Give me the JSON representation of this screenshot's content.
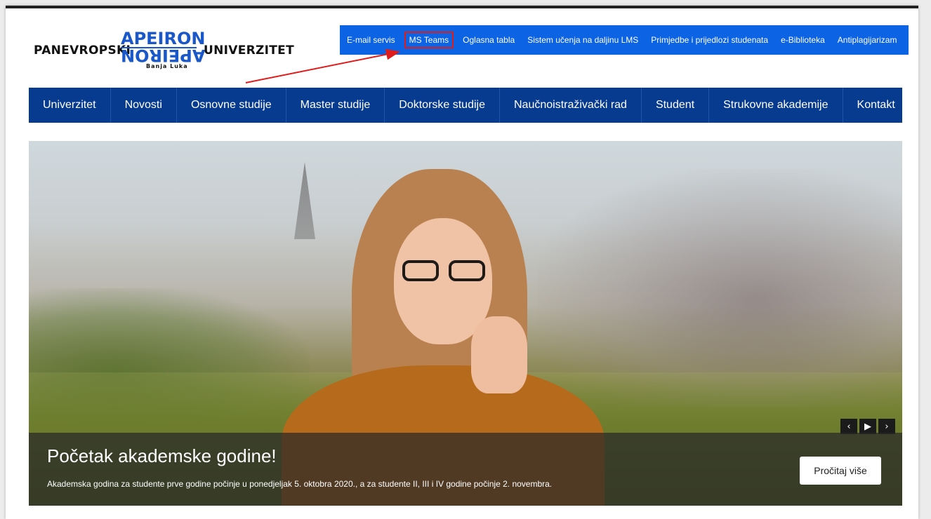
{
  "logo": {
    "left_word": "PANEVROPSKI",
    "apeiron_top": "APEIRON",
    "apeiron_bottom": "APEIRON",
    "right_word": "UNIVERZITET",
    "subtitle": "Banja Luka",
    "brand_color": "#1a57c8"
  },
  "utility_nav": {
    "background": "#0c63e4",
    "items": [
      {
        "label": "E-mail servis"
      },
      {
        "label": "MS Teams",
        "highlighted": true
      },
      {
        "label": "Oglasna tabla"
      },
      {
        "label": "Sistem učenja na daljinu LMS"
      },
      {
        "label": "Primjedbe i prijedlozi studenata"
      },
      {
        "label": "e-Biblioteka"
      },
      {
        "label": "Antiplagijarizam"
      }
    ],
    "highlight_color": "#e01b1b"
  },
  "main_nav": {
    "background": "#073b8f",
    "items": [
      {
        "label": "Univerzitet"
      },
      {
        "label": "Novosti"
      },
      {
        "label": "Osnovne studije"
      },
      {
        "label": "Master studije"
      },
      {
        "label": "Doktorske studije"
      },
      {
        "label": "Naučnoistraživački rad"
      },
      {
        "label": "Student"
      },
      {
        "label": "Strukovne akademije"
      },
      {
        "label": "Kontakt"
      }
    ]
  },
  "slider": {
    "title": "Početak akademske godine!",
    "text": "Akademska godina za studente prve godine počinje u ponedjeljak 5. oktobra 2020., a za studente II, III i IV godine počinje 2. novembra.",
    "button_label": "Pročitaj više",
    "controls": {
      "prev_icon": "chevron-left-icon",
      "play_icon": "play-icon",
      "next_icon": "chevron-right-icon",
      "prev_glyph": "‹",
      "play_glyph": "▶",
      "next_glyph": "›"
    }
  }
}
